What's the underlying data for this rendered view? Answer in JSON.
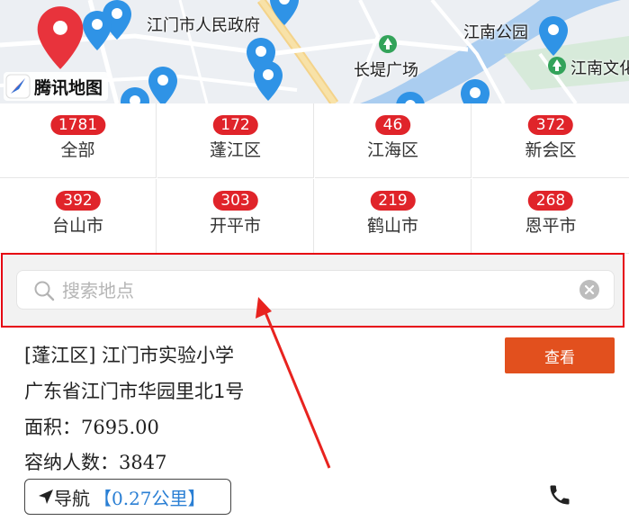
{
  "map": {
    "labels": {
      "gov": "江门市人民政府",
      "park": "江南公园",
      "square": "长堤广场",
      "culture": "江南文化"
    },
    "logo_text": "腾讯地图",
    "pin_icon": "map-pin-icon",
    "poi_icon": "tree-poi-icon"
  },
  "districts": [
    {
      "count": "1781",
      "name": "全部"
    },
    {
      "count": "172",
      "name": "蓬江区"
    },
    {
      "count": "46",
      "name": "江海区"
    },
    {
      "count": "372",
      "name": "新会区"
    },
    {
      "count": "392",
      "name": "台山市"
    },
    {
      "count": "303",
      "name": "开平市"
    },
    {
      "count": "219",
      "name": "鹤山市"
    },
    {
      "count": "268",
      "name": "恩平市"
    }
  ],
  "search": {
    "placeholder": "搜索地点",
    "value": ""
  },
  "result": {
    "title": "[蓬江区] 江门市实验小学",
    "address": "广东省江门市华园里北1号",
    "area_label": "面积：",
    "area_value": "7695.00",
    "capacity_label": "容纳人数：",
    "capacity_value": "3847",
    "view_label": "查看",
    "nav_label": "导航",
    "nav_open": "【",
    "nav_distance": "0.27",
    "nav_unit": "公里",
    "nav_close": "】"
  },
  "colors": {
    "badge": "#e0242a",
    "view_button": "#e2501e",
    "highlight": "#e60012",
    "distance": "#2a7fd4",
    "pin_red": "#e8333c",
    "pin_blue": "#2f93e6"
  }
}
